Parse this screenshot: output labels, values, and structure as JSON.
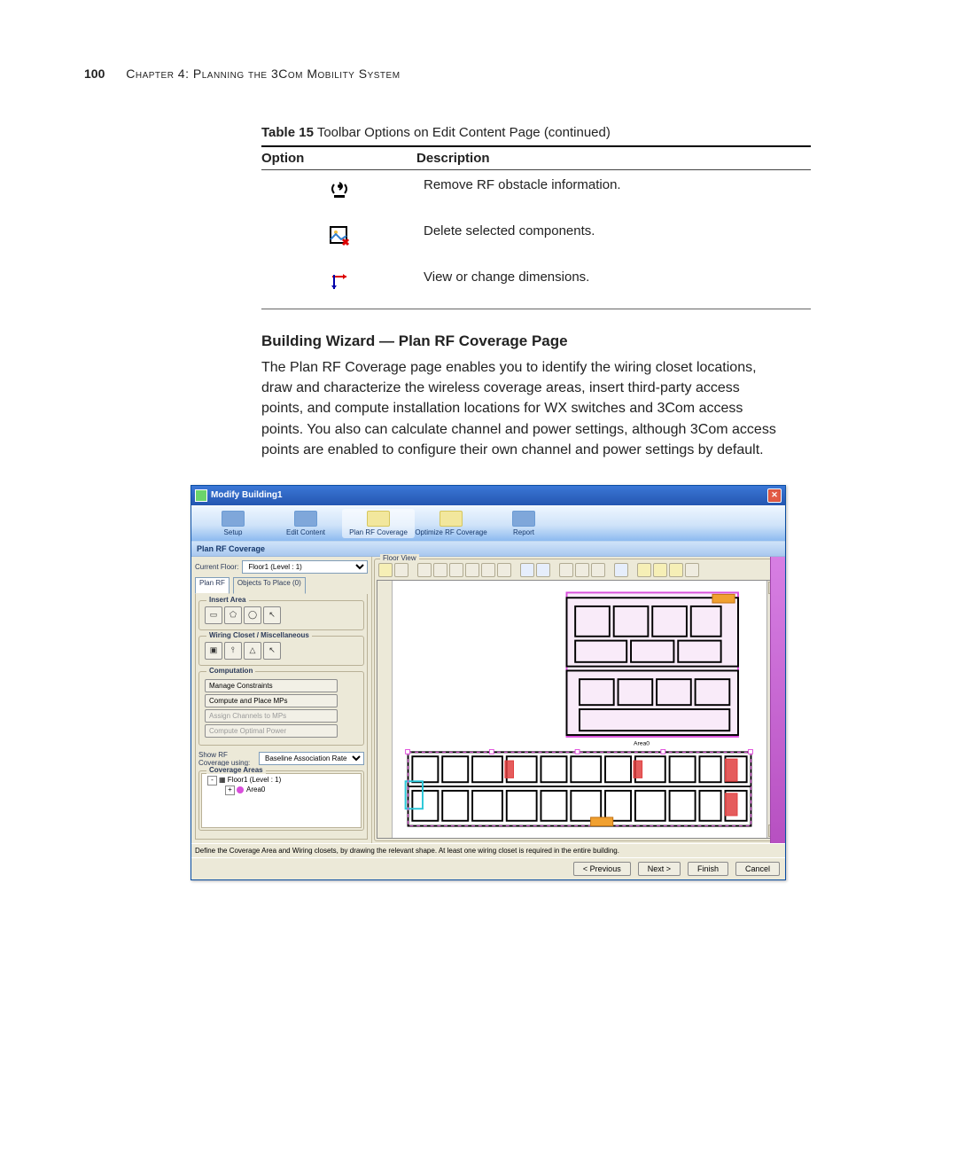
{
  "page": {
    "number": "100",
    "chapter_label": "Chapter 4: Planning the 3Com Mobility System"
  },
  "table": {
    "caption_bold": "Table 15",
    "caption_rest": "   Toolbar Options on Edit Content Page (continued)",
    "headers": {
      "option": "Option",
      "description": "Description"
    },
    "rows": [
      {
        "desc": "Remove RF obstacle information."
      },
      {
        "desc": "Delete selected components."
      },
      {
        "desc": "View or change dimensions."
      }
    ]
  },
  "section": {
    "heading": "Building Wizard — Plan RF Coverage Page",
    "body": "The Plan RF Coverage page enables you to identify the wiring closet locations, draw and characterize the wireless coverage areas, insert third-party access points, and compute installation locations for WX switches and 3Com access points. You also can calculate channel and power settings, although 3Com access points are enabled to configure their own channel and power settings by default."
  },
  "app": {
    "window_title": "Modify Building1",
    "ribbon": {
      "steps": [
        "Setup",
        "Edit Content",
        "Plan RF Coverage",
        "Optimize RF Coverage",
        "Report"
      ],
      "selected_index": 2
    },
    "subheader": "Plan RF Coverage",
    "left": {
      "current_floor_label": "Current Floor:",
      "current_floor_value": "Floor1 (Level : 1)",
      "tabs": {
        "plan_rf": "Plan RF",
        "objects": "Objects To Place (0)",
        "selected": 0
      },
      "group_insert": "Insert Area",
      "group_wiring": "Wiring Closet / Miscellaneous",
      "group_comp": "Computation",
      "comp_buttons": [
        {
          "icon": "constraints",
          "label": "Manage Constraints",
          "enabled": true
        },
        {
          "icon": "compute",
          "label": "Compute and Place MPs",
          "enabled": true
        },
        {
          "icon": "assign",
          "label": "Assign Channels to MPs",
          "enabled": false
        },
        {
          "icon": "power",
          "label": "Compute Optimal Power",
          "enabled": false
        }
      ],
      "show_rf_label": "Show RF Coverage using:",
      "show_rf_value": "Baseline Association Rate",
      "group_coverage": "Coverage Areas",
      "tree": {
        "root": "Floor1 (Level : 1)",
        "child": "Area0"
      }
    },
    "right": {
      "floor_view_label": "Floor View",
      "area_label": "Area0"
    },
    "hint": "Define the Coverage Area and Wiring closets, by drawing the relevant shape. At least one wiring closet is required in the entire building.",
    "buttons": {
      "previous": "< Previous",
      "next": "Next >",
      "finish": "Finish",
      "cancel": "Cancel"
    }
  }
}
